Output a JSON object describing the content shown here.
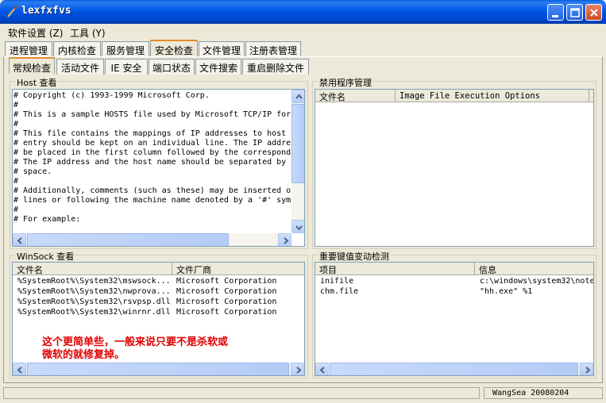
{
  "window": {
    "title": "lexfxfvs",
    "controls": [
      "minimize",
      "maximize",
      "close"
    ]
  },
  "menu": {
    "items": [
      {
        "label": "软件设置 (Z)"
      },
      {
        "label": "工具 (Y)"
      }
    ]
  },
  "main_tabs": [
    {
      "label": "进程管理"
    },
    {
      "label": "内核检查"
    },
    {
      "label": "服务管理"
    },
    {
      "label": "安全检查",
      "active": true
    },
    {
      "label": "文件管理"
    },
    {
      "label": "注册表管理"
    }
  ],
  "sub_tabs": [
    {
      "label": "常规检查",
      "active": true
    },
    {
      "label": "活动文件"
    },
    {
      "label": "IE 安全"
    },
    {
      "label": "端口状态"
    },
    {
      "label": "文件搜索"
    },
    {
      "label": "重启删除文件"
    }
  ],
  "hosts_panel": {
    "title": "Host 查看",
    "lines": [
      "# Copyright (c) 1993-1999 Microsoft Corp.",
      "#",
      "# This is a sample HOSTS file used by Microsoft TCP/IP for",
      "#",
      "# This file contains the mappings of IP addresses to host",
      "# entry should be kept on an individual line. The IP addre",
      "# be placed in the first column followed by the correspond",
      "# The IP address and the host name should be separated by",
      "# space.",
      "#",
      "# Additionally, comments (such as these) may be inserted o",
      "# lines or following the machine name denoted by a '#' sym",
      "#",
      "# For example:"
    ]
  },
  "disabled_programs_panel": {
    "title": "禁用程序管理",
    "columns": [
      "文件名",
      "Image File Execution Options"
    ]
  },
  "winsock_panel": {
    "title": "WinSock 查看",
    "columns": [
      "文件名",
      "文件厂商"
    ],
    "rows": [
      [
        "%SystemRoot%\\System32\\mswsock...",
        "Microsoft Corporation"
      ],
      [
        "%SystemRoot%\\System32\\nwprova...",
        "Microsoft Corporation"
      ],
      [
        "%SystemRoot%\\System32\\rsvpsp.dll",
        "Microsoft Corporation"
      ],
      [
        "%SystemRoot%\\System32\\winrnr.dll",
        "Microsoft Corporation"
      ]
    ]
  },
  "keys_panel": {
    "title": "重要键值变动检测",
    "columns": [
      "项目",
      "信息"
    ],
    "rows": [
      [
        "inifile",
        "c:\\windows\\system32\\note"
      ],
      [
        "chm.file",
        "\"hh.exe\" %1"
      ]
    ]
  },
  "annotation": {
    "line1": "这个更简单些，一般来说只要不是杀软或",
    "line2": "微软的就修复掉。"
  },
  "statusbar": {
    "text": "WangSea 20080204"
  }
}
